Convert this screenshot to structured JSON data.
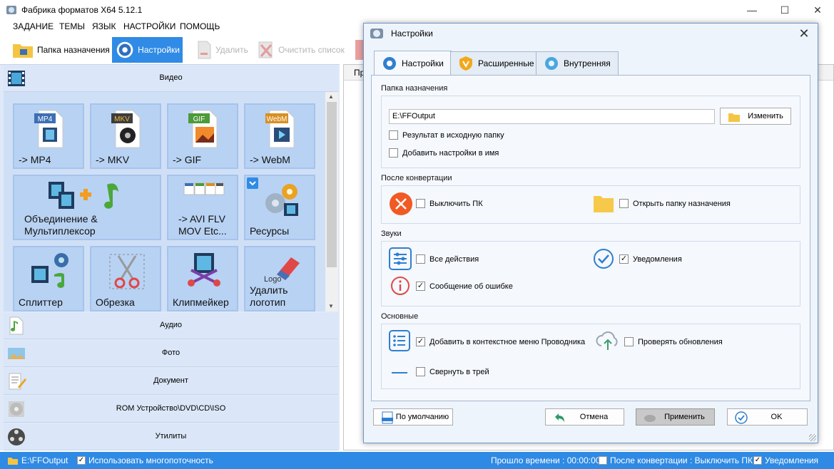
{
  "window": {
    "title": "Фабрика форматов X64 5.12.1"
  },
  "menu": [
    "ЗАДАНИЕ",
    "ТЕМЫ",
    "ЯЗЫК",
    "НАСТРОЙКИ",
    "ПОМОЩЬ"
  ],
  "toolbar": {
    "dest_folder": "Папка назначения",
    "settings": "Настройки",
    "delete": "Удалить",
    "clear_list": "Очистить список"
  },
  "categories": {
    "video": "Видео",
    "audio": "Аудио",
    "photo": "Фото",
    "document": "Документ",
    "rom": "ROM Устройство\\DVD\\CD\\ISO",
    "utilities": "Утилиты"
  },
  "tiles": [
    {
      "label": "-> MP4",
      "badge": "MP4",
      "badge_color": "#3d6fb3"
    },
    {
      "label": "-> MKV",
      "badge": "MKV",
      "badge_color": "#3d3d3d"
    },
    {
      "label": "-> GIF",
      "badge": "GIF",
      "badge_color": "#4c9a3a"
    },
    {
      "label": "-> WebM",
      "badge": "WebM",
      "badge_color": "#d98f22"
    },
    {
      "label": "Объединение & Мультиплексор"
    },
    {
      "label": "-> AVI FLV MOV Etc..."
    },
    {
      "label": "Ресурсы"
    },
    {
      "label": "Сплиттер"
    },
    {
      "label": "Обрезка"
    },
    {
      "label": "Клипмейкер"
    },
    {
      "label": "Удалить логотип",
      "logo_text": "Logo"
    }
  ],
  "right_tab_stub": "Пр",
  "status": {
    "path": "E:\\FFOutput",
    "multithread": "Использовать многопоточность",
    "elapsed": "Прошло времени : 00:00:00",
    "after_conv": "После конвертации : Выключить ПК",
    "notifications": "Уведомления"
  },
  "dialog": {
    "title": "Настройки",
    "tabs": [
      "Настройки",
      "Расширенные",
      "Внутренняя"
    ],
    "sec_dest": "Папка назначения",
    "dest_path": "E:\\FFOutput",
    "change_btn": "Изменить",
    "chk_result_source": "Результат в исходную папку",
    "chk_add_settings": "Добавить настройки в имя",
    "sec_after": "После конвертации",
    "chk_shutdown": "Выключить ПК",
    "chk_open_folder": "Открыть папку назначения",
    "sec_sounds": "Звуки",
    "chk_all_actions": "Все действия",
    "chk_notifications": "Уведомления",
    "chk_error_msg": "Сообщение об ошибке",
    "sec_main": "Основные",
    "chk_context_menu": "Добавить в контекстное меню Проводника",
    "chk_check_updates": "Проверять обновления",
    "chk_tray": "Свернуть в трей",
    "btn_default": "По умолчанию",
    "btn_cancel": "Отмена",
    "btn_apply": "Применить",
    "btn_ok": "OK"
  },
  "colors": {
    "accent": "#2f8be5",
    "status_bar": "#2e8ae4",
    "tile_bg": "#b8d2f3",
    "danger": "#f15a24"
  }
}
